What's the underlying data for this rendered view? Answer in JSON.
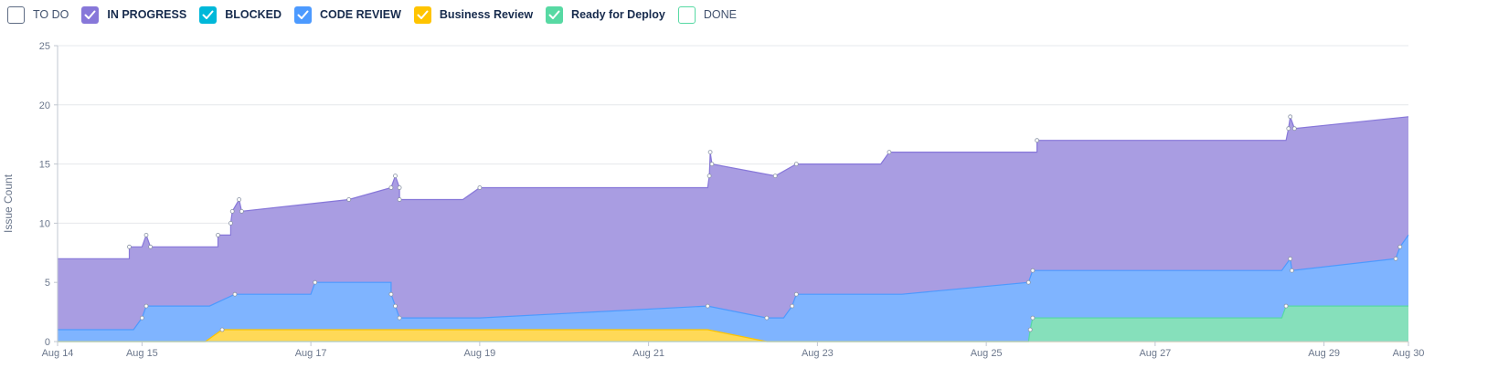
{
  "legend": [
    {
      "label": "TO DO",
      "checked": false,
      "color": "#5e6c84"
    },
    {
      "label": "IN PROGRESS",
      "checked": true,
      "color": "#8777d9"
    },
    {
      "label": "BLOCKED",
      "checked": true,
      "color": "#00b8d9"
    },
    {
      "label": "CODE REVIEW",
      "checked": true,
      "color": "#4c9aff"
    },
    {
      "label": "Business Review",
      "checked": true,
      "color": "#ffc400"
    },
    {
      "label": "Ready for Deploy",
      "checked": true,
      "color": "#57d9a3"
    },
    {
      "label": "DONE",
      "checked": false,
      "color": "#57d9a3"
    }
  ],
  "chart_data": {
    "type": "area",
    "title": "",
    "xlabel": "",
    "ylabel": "Issue Count",
    "ylim": [
      0,
      25
    ],
    "yticks": [
      0,
      5,
      10,
      15,
      20,
      25
    ],
    "xlim": [
      14,
      30
    ],
    "xticks": [
      {
        "x": 14,
        "label": "Aug 14"
      },
      {
        "x": 15,
        "label": "Aug 15"
      },
      {
        "x": 17,
        "label": "Aug 17"
      },
      {
        "x": 19,
        "label": "Aug 19"
      },
      {
        "x": 21,
        "label": "Aug 21"
      },
      {
        "x": 23,
        "label": "Aug 23"
      },
      {
        "x": 25,
        "label": "Aug 25"
      },
      {
        "x": 27,
        "label": "Aug 27"
      },
      {
        "x": 29,
        "label": "Aug 29"
      },
      {
        "x": 30,
        "label": "Aug 30"
      }
    ],
    "grid": true,
    "stacked": true,
    "series": [
      {
        "name": "IN PROGRESS",
        "fill": "#a99de2",
        "stroke": "#8777d9",
        "points": [
          [
            14,
            7
          ],
          [
            14.85,
            7
          ],
          [
            14.85,
            8
          ],
          [
            15,
            8
          ],
          [
            15.05,
            9
          ],
          [
            15.1,
            8
          ],
          [
            15.75,
            8
          ],
          [
            15.9,
            8
          ],
          [
            15.9,
            9
          ],
          [
            16.05,
            9
          ],
          [
            16.05,
            10
          ],
          [
            16.07,
            11
          ],
          [
            16.15,
            12
          ],
          [
            16.18,
            11
          ],
          [
            17.45,
            12
          ],
          [
            17.95,
            13
          ],
          [
            18.0,
            14
          ],
          [
            18.05,
            13
          ],
          [
            18.05,
            12
          ],
          [
            18.8,
            12
          ],
          [
            19.0,
            13
          ],
          [
            21.7,
            13
          ],
          [
            21.72,
            14
          ],
          [
            21.73,
            16
          ],
          [
            21.75,
            15
          ],
          [
            22.5,
            14
          ],
          [
            22.75,
            15
          ],
          [
            23.75,
            15
          ],
          [
            23.85,
            16
          ],
          [
            25.6,
            16
          ],
          [
            25.6,
            17
          ],
          [
            28.55,
            17
          ],
          [
            28.58,
            18
          ],
          [
            28.6,
            19
          ],
          [
            28.65,
            18
          ],
          [
            30,
            19
          ]
        ]
      },
      {
        "name": "CODE REVIEW",
        "fill": "#7fb4ff",
        "stroke": "#4c9aff",
        "points": [
          [
            14,
            1
          ],
          [
            14.9,
            1
          ],
          [
            15.0,
            2
          ],
          [
            15.05,
            3
          ],
          [
            15.8,
            3
          ],
          [
            16.1,
            4
          ],
          [
            17.0,
            4
          ],
          [
            17.05,
            5
          ],
          [
            17.95,
            5
          ],
          [
            17.95,
            4
          ],
          [
            18.0,
            3
          ],
          [
            18.05,
            2
          ],
          [
            19.0,
            2
          ],
          [
            21.7,
            3
          ],
          [
            22.4,
            2
          ],
          [
            22.6,
            2
          ],
          [
            22.7,
            3
          ],
          [
            22.75,
            4
          ],
          [
            24.0,
            4
          ],
          [
            25.5,
            5
          ],
          [
            25.55,
            6
          ],
          [
            28.5,
            6
          ],
          [
            28.6,
            7
          ],
          [
            28.62,
            6
          ],
          [
            29.85,
            7
          ],
          [
            29.9,
            8
          ],
          [
            30,
            9
          ]
        ]
      },
      {
        "name": "Business Review",
        "fill": "#ffd957",
        "stroke": "#ffc400",
        "points": [
          [
            14,
            0
          ],
          [
            15.75,
            0
          ],
          [
            15.95,
            1
          ],
          [
            21.7,
            1
          ],
          [
            22.4,
            0
          ],
          [
            30,
            0
          ]
        ]
      },
      {
        "name": "Ready for Deploy",
        "fill": "#86e0bb",
        "stroke": "#57d9a3",
        "points": [
          [
            14,
            0
          ],
          [
            25.5,
            0
          ],
          [
            25.52,
            1
          ],
          [
            25.55,
            2
          ],
          [
            28.5,
            2
          ],
          [
            28.55,
            3
          ],
          [
            30,
            3
          ]
        ]
      }
    ]
  }
}
